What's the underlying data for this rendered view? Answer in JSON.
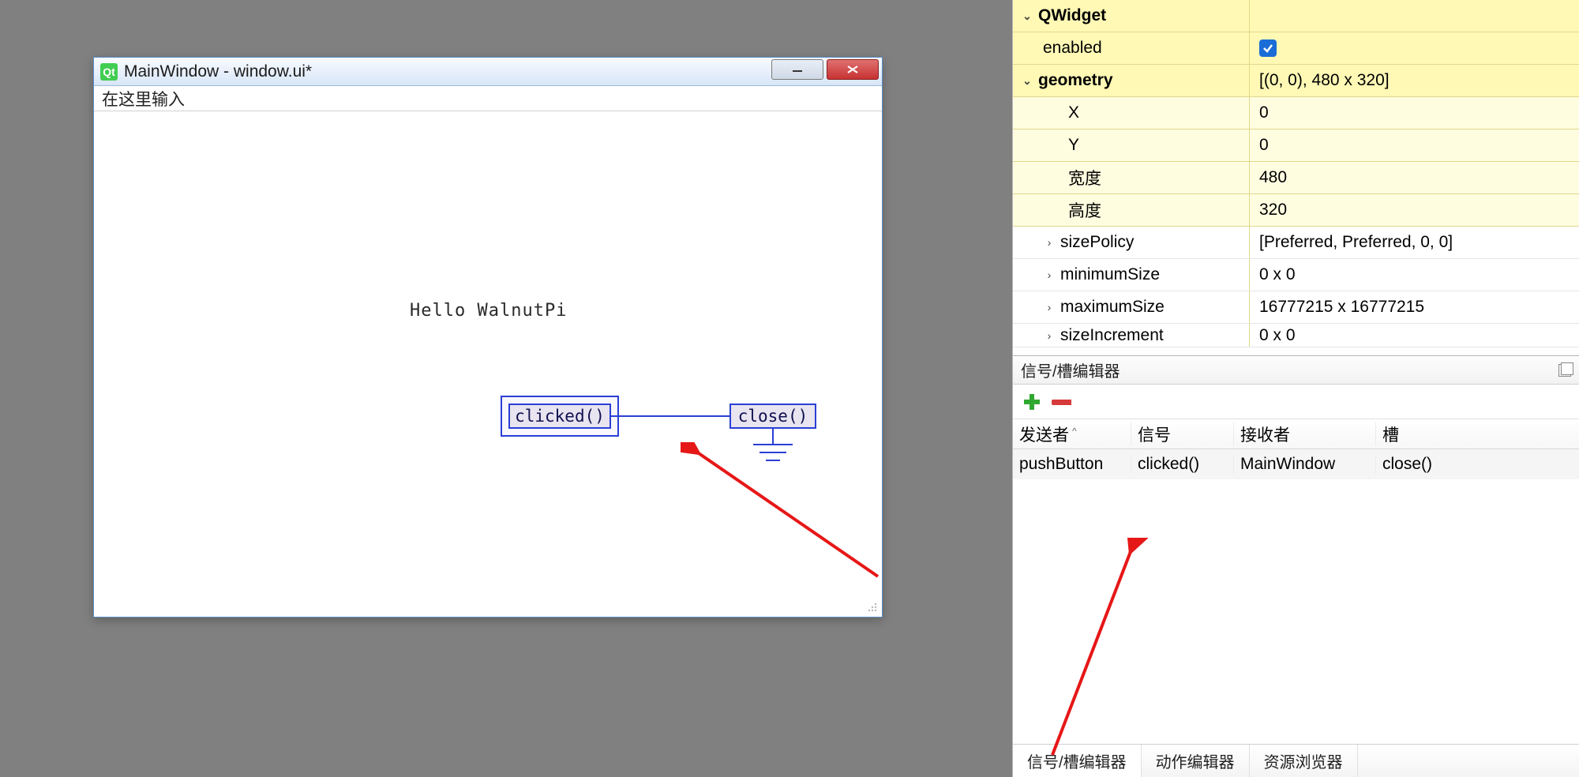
{
  "designer": {
    "title": "MainWindow - window.ui*",
    "menu_placeholder": "在这里输入",
    "form_label": "Hello WalnutPi",
    "signal_source": "clicked()",
    "signal_target": "close()"
  },
  "properties": {
    "group": "QWidget",
    "rows": [
      {
        "key": "enabled",
        "val": "",
        "checked": true
      },
      {
        "key": "geometry",
        "val": "[(0, 0), 480 x 320]",
        "expandable": true
      },
      {
        "key": "X",
        "val": "0",
        "sub": true
      },
      {
        "key": "Y",
        "val": "0",
        "sub": true
      },
      {
        "key": "宽度",
        "val": "480",
        "sub": true
      },
      {
        "key": "高度",
        "val": "320",
        "sub": true
      },
      {
        "key": "sizePolicy",
        "val": "[Preferred, Preferred, 0, 0]",
        "white": true
      },
      {
        "key": "minimumSize",
        "val": "0 x 0",
        "white": true
      },
      {
        "key": "maximumSize",
        "val": "16777215 x 16777215",
        "white": true
      },
      {
        "key": "sizeIncrement",
        "val": "0 x 0",
        "white": true
      }
    ]
  },
  "signal_editor": {
    "title": "信号/槽编辑器",
    "columns": {
      "sender": "发送者",
      "signal": "信号",
      "receiver": "接收者",
      "slot": "槽"
    },
    "row": {
      "sender": "pushButton",
      "signal": "clicked()",
      "receiver": "MainWindow",
      "slot": "close()"
    }
  },
  "tabs": {
    "signal_slot": "信号/槽编辑器",
    "action": "动作编辑器",
    "resource": "资源浏览器"
  }
}
